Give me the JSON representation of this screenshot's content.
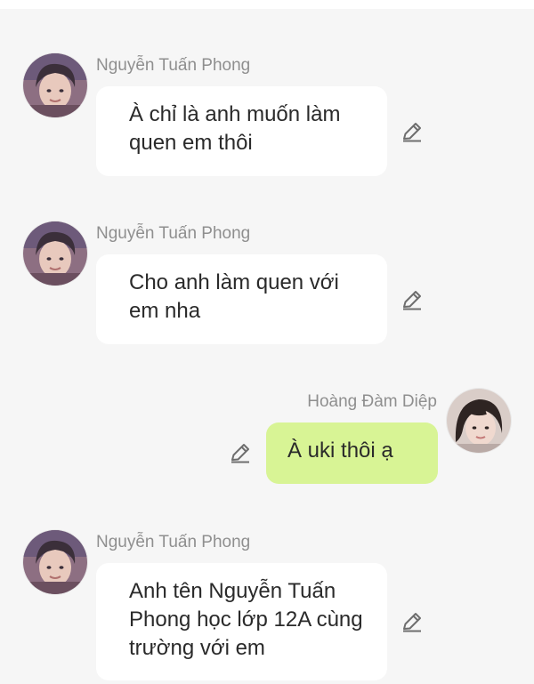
{
  "messages": [
    {
      "sender": "Nguyễn Tuấn Phong",
      "text": "À chỉ là anh muốn làm quen em thôi",
      "avatar_icon": "male-avatar",
      "edit_icon": "pencil-icon"
    },
    {
      "sender": "Nguyễn Tuấn Phong",
      "text": "Cho anh làm quen với em nha",
      "avatar_icon": "male-avatar",
      "edit_icon": "pencil-icon"
    },
    {
      "sender": "Hoàng Đàm Diệp",
      "text": "À uki thôi ạ",
      "avatar_icon": "female-avatar",
      "edit_icon": "pencil-icon"
    },
    {
      "sender": "Nguyễn Tuấn Phong",
      "text": "Anh tên Nguyễn Tuấn Phong học lớp 12A cùng trường với em",
      "avatar_icon": "male-avatar",
      "edit_icon": "pencil-icon"
    }
  ],
  "colors": {
    "background": "#f6f6f6",
    "incoming_bubble": "#ffffff",
    "outgoing_bubble": "#d8f495",
    "sender_name": "#8f8f8f",
    "message_text": "#2a2a2a"
  }
}
